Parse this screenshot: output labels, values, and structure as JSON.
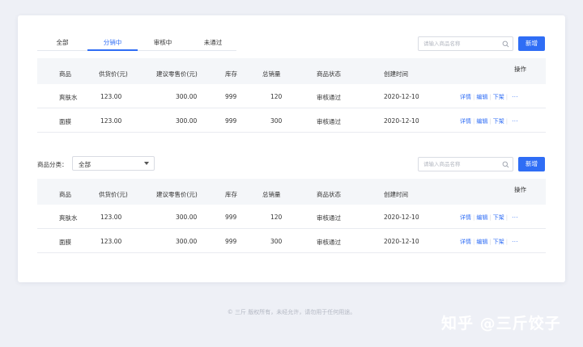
{
  "tabs": [
    "全部",
    "分销中",
    "审核中",
    "未通过"
  ],
  "active_tab": "分销中",
  "search": {
    "placeholder": "请输入商品名称"
  },
  "add_button": "新增",
  "filter": {
    "label": "商品分类：",
    "value": "全部"
  },
  "columns": [
    "商品",
    "供货价(元)",
    "建议零售价(元)",
    "库存",
    "总销量",
    "商品状态",
    "创建时间",
    "操作"
  ],
  "row_actions": [
    "详情",
    "编辑",
    "下架"
  ],
  "more_label": "···",
  "table1": {
    "rows": [
      [
        "爽肤水",
        "123.00",
        "300.00",
        "999",
        "120",
        "审核通过",
        "2020-12-10"
      ],
      [
        "面膜",
        "123.00",
        "300.00",
        "999",
        "300",
        "审核通过",
        "2020-12-10"
      ]
    ]
  },
  "table2": {
    "rows": [
      [
        "爽肤水",
        "123.00",
        "300.00",
        "999",
        "120",
        "审核通过",
        "2020-12-10"
      ],
      [
        "面膜",
        "123.00",
        "300.00",
        "999",
        "300",
        "审核通过",
        "2020-12-10"
      ]
    ]
  },
  "footer": "© 三斤 版权所有，未经允许，请勿用于任何用途。",
  "watermark": "知乎 @三斤饺子",
  "colors": {
    "accent": "#2f6df5",
    "background": "#eef0f6",
    "header_row": "#f4f6f9"
  }
}
